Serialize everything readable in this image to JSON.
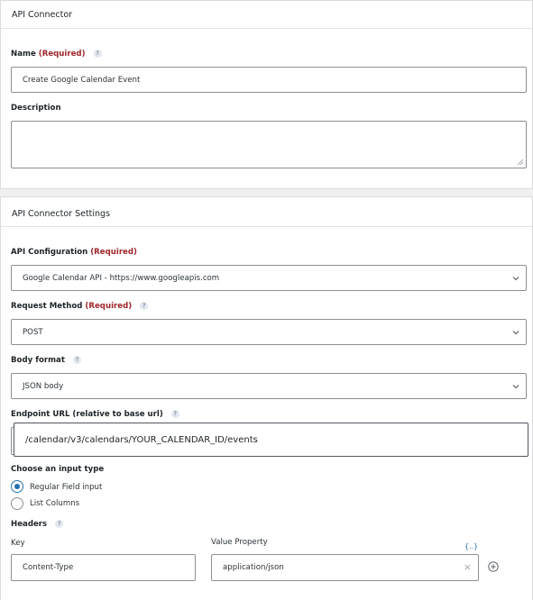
{
  "panel_general": {
    "title": "API Connector",
    "name_label": "Name",
    "required_text": "(Required)",
    "help_glyph": "?",
    "name_value": "Create Google Calendar Event",
    "description_label": "Description",
    "description_value": ""
  },
  "panel_settings": {
    "title": "API Connector Settings",
    "api_config_label": "API Configuration",
    "api_config_value": "Google Calendar API - https://www.googleapis.com",
    "request_method_label": "Request Method",
    "request_method_value": "POST",
    "body_format_label": "Body format",
    "body_format_value": "JSON body",
    "endpoint_label": "Endpoint URL (relative to base url)",
    "endpoint_value": "/calendar/v3/calendars/YOUR_CALENDAR_ID/events",
    "input_type_label": "Choose an input type",
    "input_type_options": [
      {
        "label": "Regular Field input",
        "selected": true
      },
      {
        "label": "List Columns",
        "selected": false
      }
    ],
    "headers_label": "Headers",
    "headers_key_label": "Key",
    "headers_value_label": "Value Property",
    "merge_tag_glyph": "{..}",
    "header_rows": [
      {
        "key": "Content-Type",
        "value": "application/json"
      }
    ],
    "clear_glyph": "×",
    "add_glyph": "+"
  },
  "icons": {
    "help": "help-icon",
    "dropdown": "chevron-down-icon",
    "merge_tags": "merge-tags-icon",
    "clear": "close-icon",
    "add": "add-circle-icon"
  },
  "colors": {
    "required": "#a0262a",
    "radio_accent": "#2271b1",
    "border": "#8c8f94"
  }
}
